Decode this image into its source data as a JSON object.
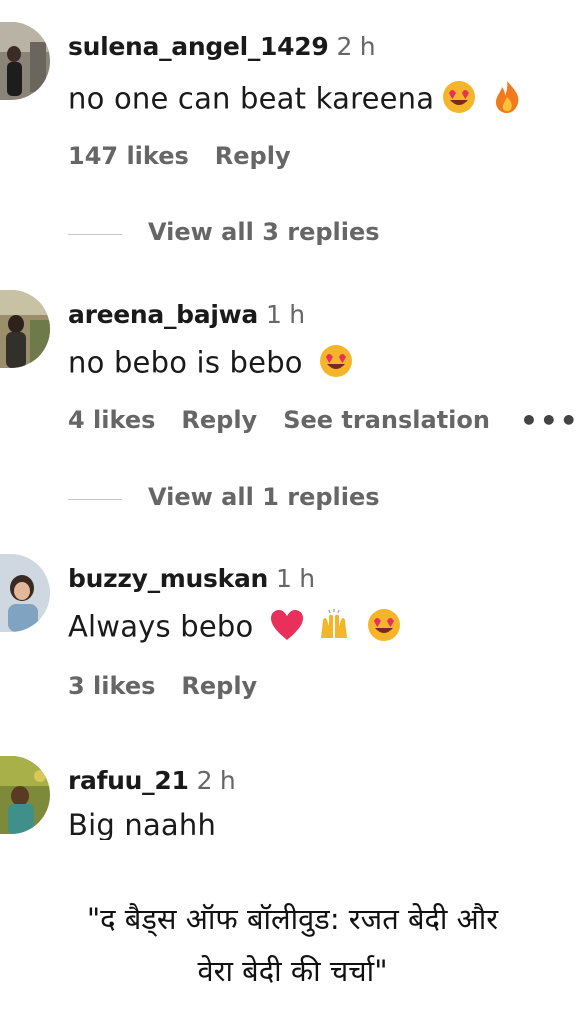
{
  "comments": [
    {
      "username": "sulena_angel_1429",
      "time": "2 h",
      "text": "no one can beat kareena",
      "emojis": [
        "heart-eyes-emoji",
        "fire-emoji"
      ],
      "likes": "147 likes",
      "reply": "Reply",
      "view_replies": "View all 3 replies"
    },
    {
      "username": "areena_bajwa",
      "time": "1 h",
      "text": "no bebo is bebo",
      "emojis": [
        "heart-eyes-emoji"
      ],
      "likes": "4 likes",
      "reply": "Reply",
      "see_translation": "See translation",
      "more": "•••",
      "view_replies": "View all 1 replies"
    },
    {
      "username": "buzzy_muskan",
      "time": "1 h",
      "text": "Always bebo",
      "emojis": [
        "heart-emoji",
        "raising-hands-emoji",
        "heart-eyes-emoji"
      ],
      "likes": "3 likes",
      "reply": "Reply"
    },
    {
      "username": "rafuu_21",
      "time": "2 h",
      "text": "Big naahh"
    }
  ],
  "caption": {
    "line1": "\"द बैड्स ऑफ बॉलीवुड: रजत बेदी और",
    "line2": "वेरा बेदी की चर्चा\""
  },
  "colors": {
    "text": "#1a1a1a",
    "muted": "#666666",
    "divider": "#c7c7c7",
    "background": "#ffffff"
  }
}
